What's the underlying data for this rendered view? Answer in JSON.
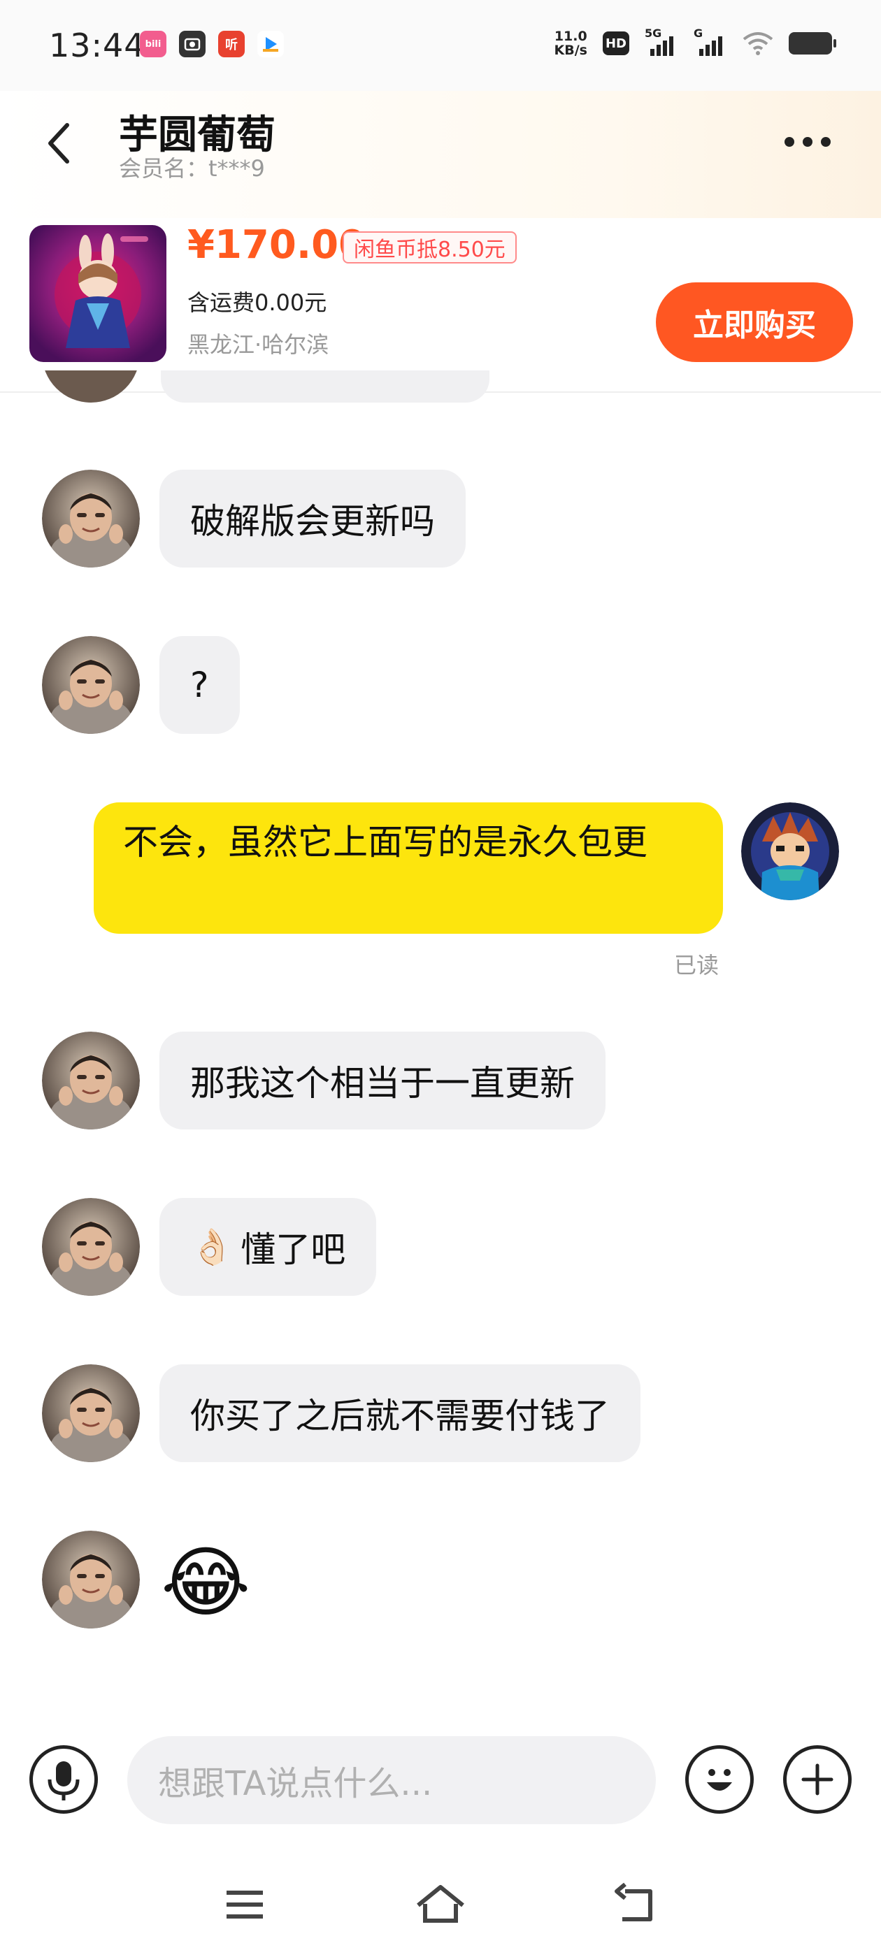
{
  "status_bar": {
    "time": "13:44",
    "apps": [
      {
        "name": "bilibili-icon",
        "label": "bili",
        "color": "#f25d8e"
      },
      {
        "name": "camera-app-icon",
        "label": "",
        "color": "#333333"
      },
      {
        "name": "ting-app-icon",
        "label": "听",
        "color": "#e8412f"
      },
      {
        "name": "video-app-icon",
        "label": "",
        "color": "#ffffff"
      }
    ],
    "net_speed_value": "11.0",
    "net_speed_unit": "KB/s",
    "hd_label": "HD",
    "sim1_label": "5G",
    "sim2_label": "G"
  },
  "header": {
    "contact_name": "芋圆葡萄",
    "member_label": "会员名：t***9"
  },
  "product": {
    "price": "¥170.00",
    "coin_tag": "闲鱼币抵8.50元",
    "shipping": "含运费0.00元",
    "location": "黑龙江·哈尔滨",
    "buy_label": "立即购买"
  },
  "messages": [
    {
      "side": "left",
      "text": "破解版会更新吗"
    },
    {
      "side": "left",
      "text": "?"
    },
    {
      "side": "right",
      "text": "不会，虽然它上面写的是永久包更",
      "read": "已读"
    },
    {
      "side": "left",
      "text": "那我这个相当于一直更新"
    },
    {
      "side": "left",
      "emoji": "👌🏻",
      "text": "懂了吧"
    },
    {
      "side": "left",
      "text": "你买了之后就不需要付钱了"
    },
    {
      "side": "left",
      "sticker": "😂"
    }
  ],
  "input": {
    "placeholder": "想跟TA说点什么..."
  },
  "colors": {
    "accent": "#ff5722",
    "price": "#ff5a1f",
    "my_bubble": "#fde50d",
    "their_bubble": "#f0f0f2"
  }
}
